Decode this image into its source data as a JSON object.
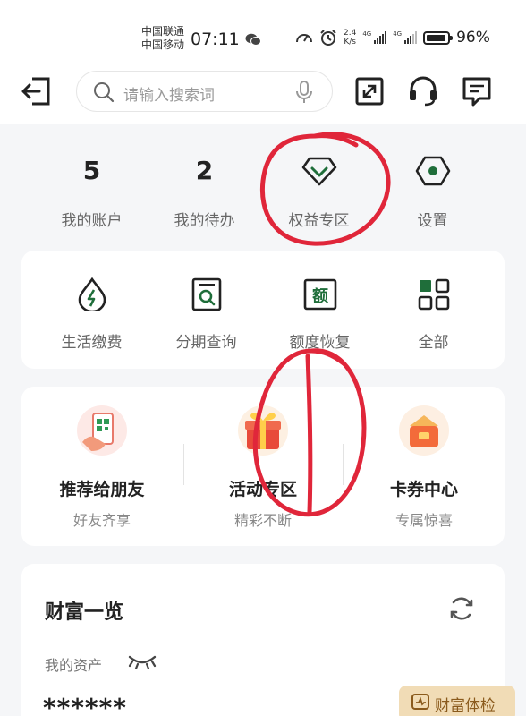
{
  "status_bar": {
    "carrier1": "中国联通",
    "carrier2": "中国移动",
    "time": "07:11",
    "speed_value": "2.4",
    "speed_unit": "K/s",
    "net1": "4G",
    "net2": "4G",
    "battery": "96%"
  },
  "header": {
    "search_placeholder": "请输入搜索词"
  },
  "top_row": [
    {
      "value": "5",
      "label": "我的账户"
    },
    {
      "value": "2",
      "label": "我的待办"
    },
    {
      "icon": "diamond-icon",
      "label": "权益专区"
    },
    {
      "icon": "settings-icon",
      "label": "设置"
    }
  ],
  "services": [
    {
      "icon": "utility-bill-icon",
      "label": "生活缴费"
    },
    {
      "icon": "installment-query-icon",
      "label": "分期查询"
    },
    {
      "icon": "credit-restore-icon",
      "label": "额度恢复",
      "icon_text": "额"
    },
    {
      "icon": "grid-all-icon",
      "label": "全部"
    }
  ],
  "promos": [
    {
      "icon": "qr-phone-icon",
      "title": "推荐给朋友",
      "subtitle": "好友齐享"
    },
    {
      "icon": "gift-box-icon",
      "title": "活动专区",
      "subtitle": "精彩不断"
    },
    {
      "icon": "coupon-box-icon",
      "title": "卡券中心",
      "subtitle": "专属惊喜"
    }
  ],
  "wealth": {
    "title": "财富一览",
    "asset_label": "我的资产",
    "asset_value": "******"
  },
  "float_button": {
    "label": "财富体检"
  },
  "colors": {
    "brand_green": "#1f6e3a",
    "annotation_red": "#e0263a",
    "float_bg": "#f1dcb6"
  }
}
